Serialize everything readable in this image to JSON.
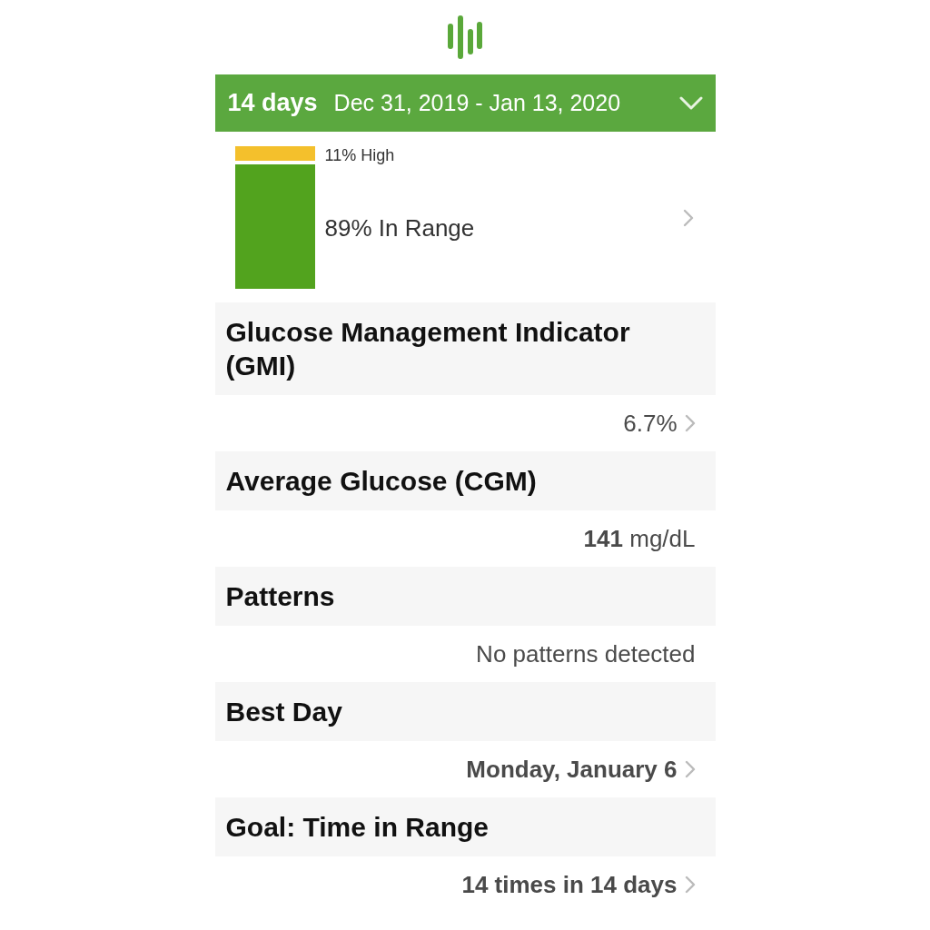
{
  "header": {
    "period": "14 days",
    "date_range": "Dec 31, 2019 - Jan 13, 2020",
    "expanded": false
  },
  "time_in_range": {
    "segments": [
      {
        "label": "11% High",
        "color": "#f4c02c",
        "kind": "small"
      },
      {
        "label": "89% In Range",
        "color": "#52a31e",
        "kind": "large"
      }
    ],
    "chevron": true
  },
  "sections": [
    {
      "title": "Glucose Management Indicator (GMI)",
      "value": "6.7%",
      "emphasis": false,
      "chevron": true
    },
    {
      "title": "Average Glucose (CGM)",
      "value": "**141** mg/dL",
      "emphasis": false,
      "chevron": false
    },
    {
      "title": "Patterns",
      "value": "No patterns detected",
      "emphasis": false,
      "chevron": false
    },
    {
      "title": "Best Day",
      "value": "Monday, January 6",
      "emphasis": true,
      "chevron": true
    },
    {
      "title": "Goal: Time in Range",
      "value": "14 times in 14 days",
      "emphasis": true,
      "chevron": true
    }
  ]
}
